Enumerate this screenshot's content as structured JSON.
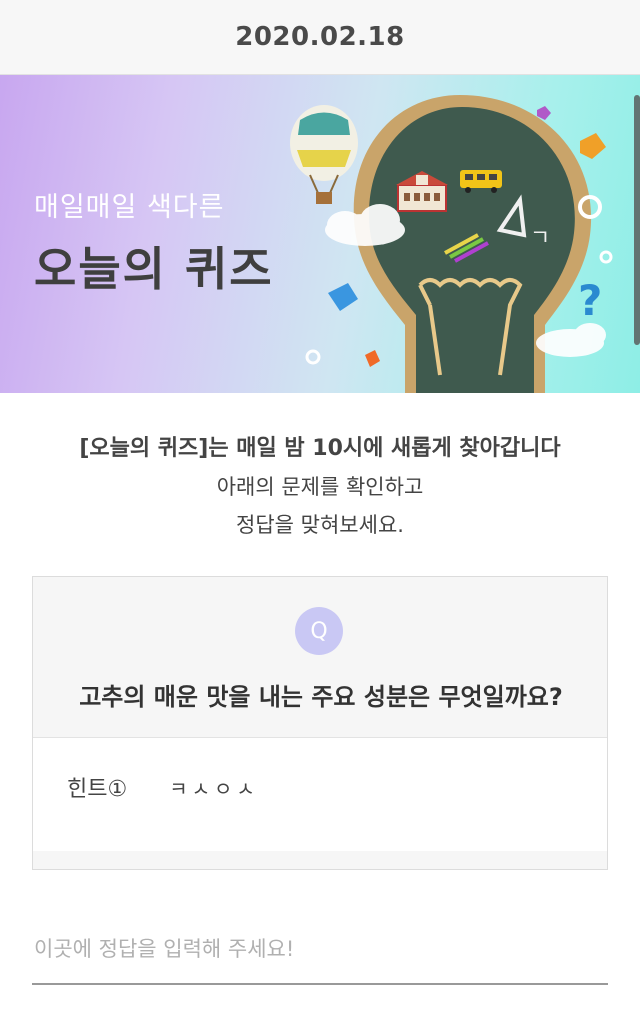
{
  "header": {
    "date": "2020.02.18"
  },
  "banner": {
    "subtitle": "매일매일 색다른",
    "title": "오늘의 퀴즈"
  },
  "intro": {
    "line1": "[오늘의 퀴즈]는 매일 밤 10시에 새롭게 찾아갑니다",
    "line2": "아래의 문제를 확인하고",
    "line3": "정답을 맞혀보세요."
  },
  "quiz": {
    "badge": "Q",
    "question": "고추의 매운 맛을 내는 주요 성분은 무엇일까요?",
    "hint_label": "힌트①",
    "hint_value": "ㅋㅅㅇㅅ"
  },
  "answer": {
    "placeholder": "이곳에 정답을 입력해 주세요!"
  },
  "colors": {
    "badge": "#c9c8f4",
    "hint_highlight": "#f8dc86",
    "chalkboard": "#3f5a4e"
  }
}
